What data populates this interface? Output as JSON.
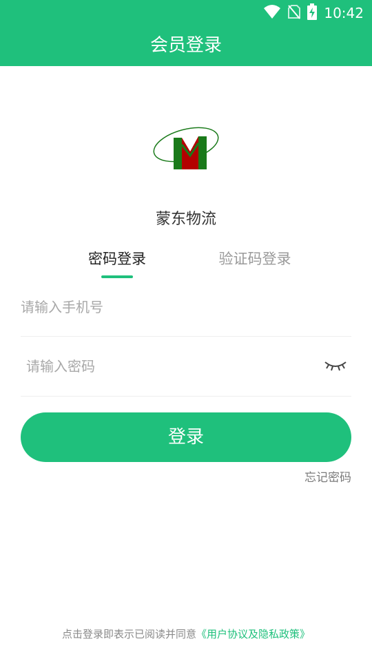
{
  "status_bar": {
    "time": "10:42",
    "icons": [
      "wifi-icon",
      "no-sim-icon",
      "battery-charging-icon"
    ]
  },
  "header": {
    "title": "会员登录"
  },
  "brand": {
    "name": "蒙东物流",
    "logo_icon": "company-logo-m-icon"
  },
  "tabs": [
    {
      "label": "密码登录",
      "active": true
    },
    {
      "label": "验证码登录",
      "active": false
    }
  ],
  "form": {
    "phone": {
      "value": "",
      "placeholder": "请输入手机号"
    },
    "password": {
      "value": "",
      "placeholder": "请输入密码",
      "toggle_icon": "eye-closed-icon"
    },
    "login_button": "登录",
    "forgot_password": "忘记密码"
  },
  "agreement": {
    "prefix": "点击登录即表示已阅读并同意",
    "link": "《用户协议及隐私政策》"
  },
  "colors": {
    "primary": "#1fc07c",
    "logo_green": "#1a7a1a",
    "logo_red": "#b30000"
  }
}
